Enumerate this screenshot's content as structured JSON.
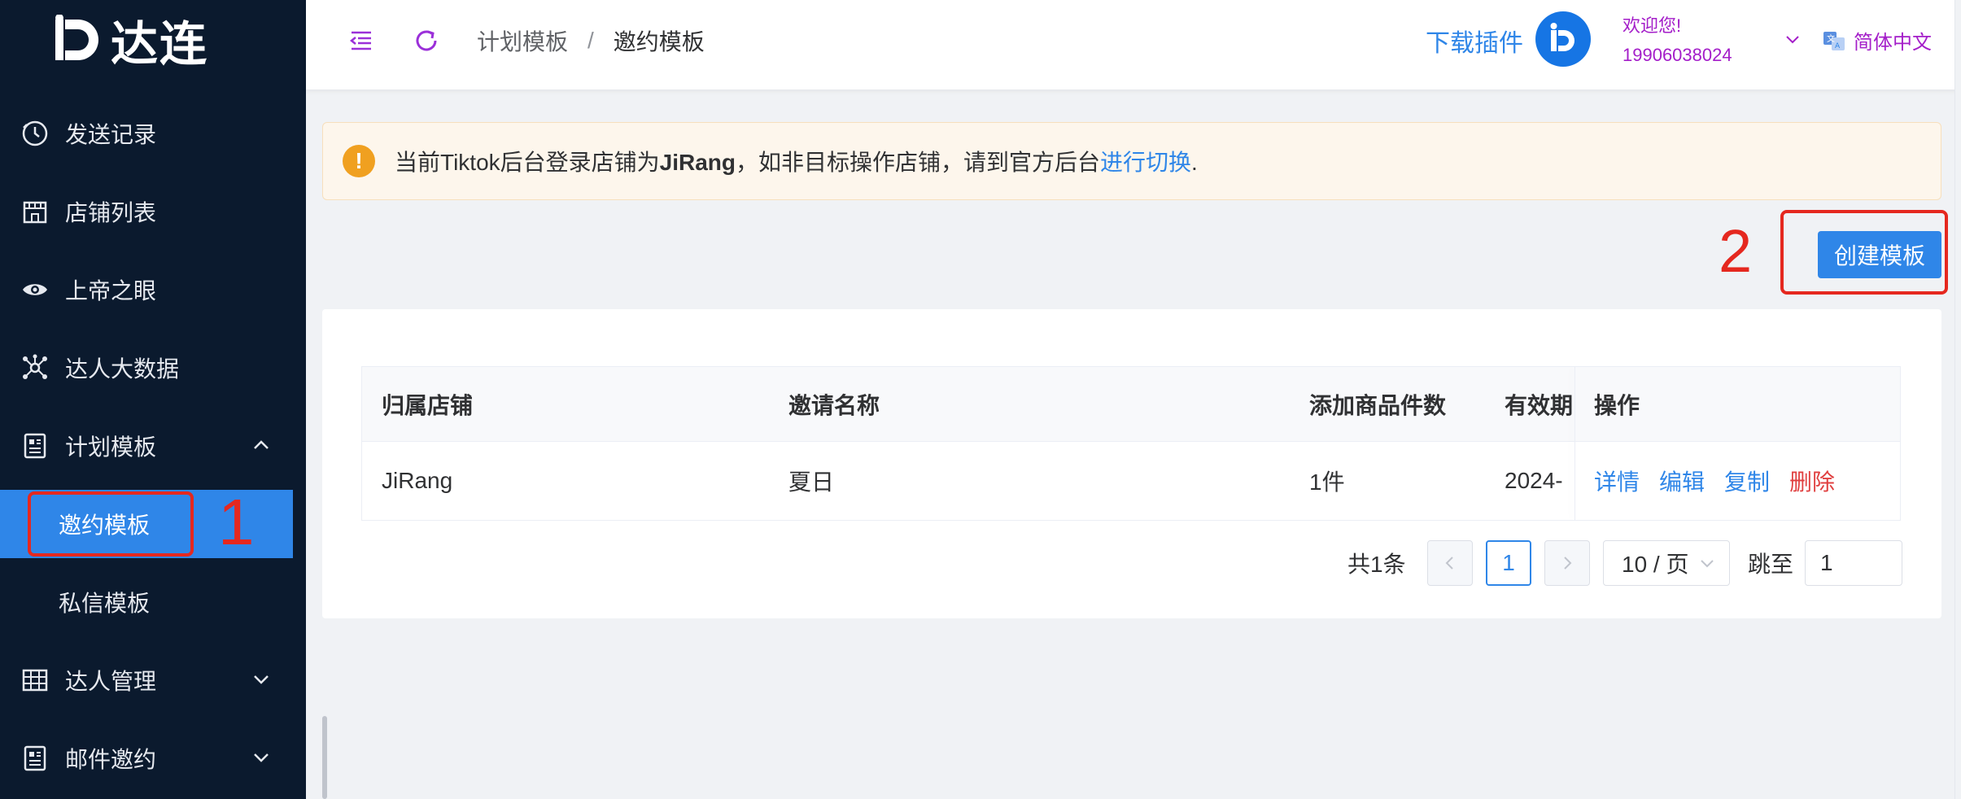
{
  "app": {
    "logo_text": "达连"
  },
  "sidebar": {
    "items": [
      {
        "label": "发送记录",
        "icon": "clock-icon"
      },
      {
        "label": "店铺列表",
        "icon": "store-icon"
      },
      {
        "label": "上帝之眼",
        "icon": "eye-icon"
      },
      {
        "label": "达人大数据",
        "icon": "network-icon"
      },
      {
        "label": "计划模板",
        "icon": "document-icon",
        "expanded": true
      },
      {
        "label": "达人管理",
        "icon": "grid-icon"
      },
      {
        "label": "邮件邀约",
        "icon": "document-icon"
      }
    ],
    "sub_items": [
      {
        "label": "邀约模板",
        "active": true
      },
      {
        "label": "私信模板",
        "active": false
      }
    ],
    "annotation_1": "1"
  },
  "header": {
    "breadcrumb": [
      "计划模板",
      "邀约模板"
    ],
    "breadcrumb_sep": "/",
    "download_label": "下载插件",
    "welcome_line": "欢迎您!",
    "user_phone": "19906038024",
    "language": "简体中文"
  },
  "alert": {
    "prefix": "当前Tiktok后台登录店铺为",
    "shop": "JiRang",
    "middle": "，如非目标操作店铺，请到官方后台",
    "link": "进行切换",
    "suffix": "."
  },
  "toolbar": {
    "create_label": "创建模板",
    "annotation_2": "2"
  },
  "table": {
    "headers": {
      "shop": "归属店铺",
      "name": "邀请名称",
      "count": "添加商品件数",
      "valid": "有效期",
      "ops": "操作"
    },
    "rows": [
      {
        "shop": "JiRang",
        "name": "夏日",
        "count": "1件",
        "valid": "2024-"
      }
    ],
    "ops": {
      "detail": "详情",
      "edit": "编辑",
      "copy": "复制",
      "delete": "删除"
    }
  },
  "pagination": {
    "total": "共1条",
    "current_page": "1",
    "page_size": "10 / 页",
    "goto_label": "跳至",
    "goto_value": "1"
  },
  "colors": {
    "sidebar_bg": "#0b1a2e",
    "accent": "#2f86e8",
    "welcome": "#a41ec9",
    "annotation": "#e5281f",
    "danger": "#e04040"
  }
}
